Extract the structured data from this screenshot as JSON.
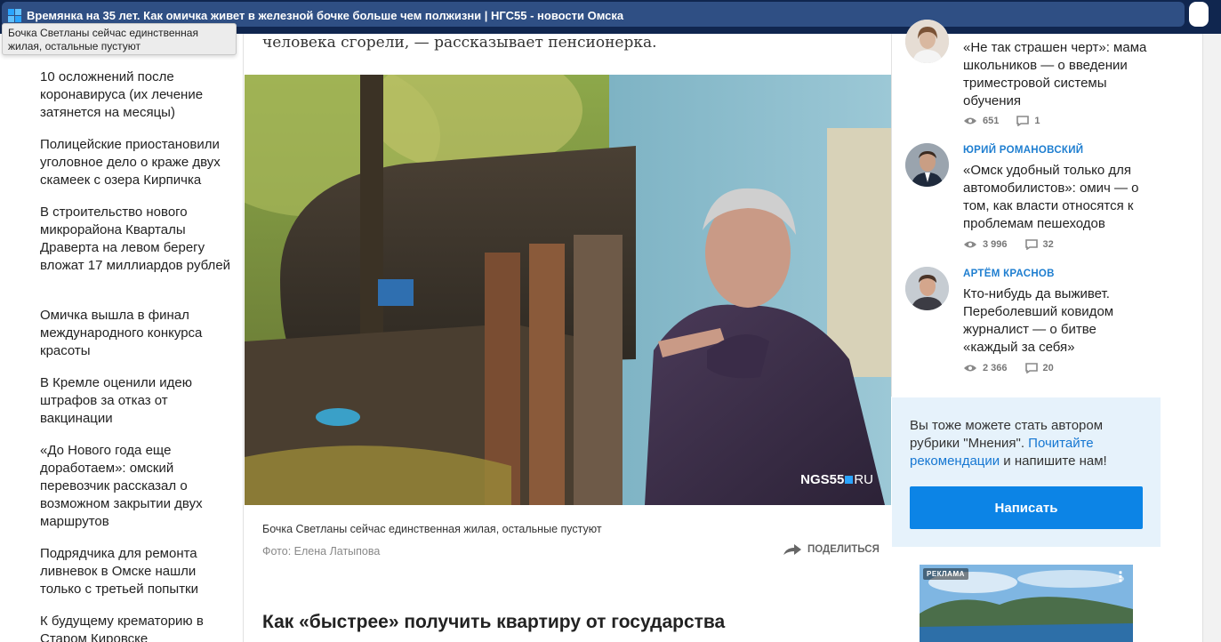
{
  "window": {
    "title": "Времянка на 35 лет. Как омичка живет в железной бочке больше чем полжизни | НГС55 - новости Омска",
    "tooltip": "Бочка Светланы сейчас единственная жилая, остальные пустуют"
  },
  "sidebar": {
    "items": [
      {
        "label": "10 осложнений после коронавируса (их лечение затянется на месяцы)"
      },
      {
        "label": "Полицейские приостановили уголовное дело о краже двух скамеек с озера Кирпичка"
      },
      {
        "label": "В строительство нового микрорайона Кварталы Драверта на левом берегу вложат 17 миллиардов рублей"
      },
      {
        "label": "Омичка вышла в финал международного конкурса красоты"
      },
      {
        "label": "В Кремле оценили идею штрафов за отказ от вакцинации"
      },
      {
        "label": "«До Нового года еще доработаем»: омский перевозчик рассказал о возможном закрытии двух маршрутов"
      },
      {
        "label": "Подрядчика для ремонта ливневок в Омске нашли только с третьей попытки"
      },
      {
        "label": "К будущему крематорию в Старом Кировске"
      }
    ]
  },
  "article": {
    "lead_fragment": "человека сгорели, — рассказывает пенсионерка.",
    "photo_watermark": "NGS55",
    "photo_watermark_suffix": "RU",
    "caption": "Бочка Светланы сейчас единственная жилая, остальные пустуют",
    "credit": "Фото: Елена Латыпова",
    "share_label": "ПОДЕЛИТЬСЯ",
    "subheading": "Как «быстрее» получить квартиру от государства"
  },
  "opinions": [
    {
      "author": "",
      "text": "«Не так страшен черт»: мама школьников — о введении триместровой системы обучения",
      "views": "651",
      "comments": "1"
    },
    {
      "author": "ЮРИЙ РОМАНОВСКИЙ",
      "text": "«Омск удобный только для автомобилистов»: омич — о том, как власти относятся к проблемам пешеходов",
      "views": "3 996",
      "comments": "32"
    },
    {
      "author": "АРТЁМ КРАСНОВ",
      "text": "Кто-нибудь да выживет. Переболевший ковидом журналист — о битве «каждый за себя»",
      "views": "2 366",
      "comments": "20"
    }
  ],
  "cta": {
    "text_before": "Вы тоже можете стать автором рубрики \"Мнения\". ",
    "link": "Почитайте рекомендации",
    "text_after": " и напишите нам!",
    "button": "Написать"
  },
  "ad": {
    "badge": "РЕКЛАМА",
    "menu_icon": "⋮"
  },
  "colors": {
    "titlebar": "#10264f",
    "accent": "#0c84e6",
    "link": "#1677d2",
    "author": "#1e7ed0"
  }
}
